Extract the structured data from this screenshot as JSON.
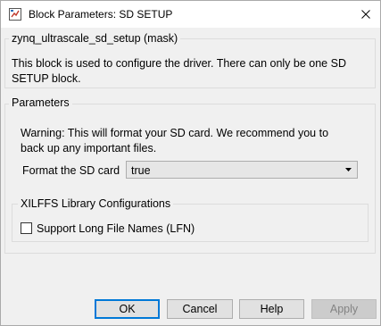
{
  "window": {
    "title": "Block Parameters: SD SETUP"
  },
  "description_group": {
    "legend": "zynq_ultrascale_sd_setup (mask)",
    "text_line1": "This block is used to configure the driver. There can only be one SD",
    "text_line2": "SETUP block."
  },
  "parameters_group": {
    "legend": "Parameters",
    "warning_line1": "Warning: This will format your SD card. We recommend you to",
    "warning_line2": "back up any important files.",
    "format_label": "Format the SD card",
    "format_value": "true"
  },
  "xilffs_group": {
    "legend": "XILFFS Library Configurations",
    "lfn_label": "Support Long File Names (LFN)",
    "lfn_checked": false
  },
  "buttons": {
    "ok": "OK",
    "cancel": "Cancel",
    "help": "Help",
    "apply": "Apply"
  },
  "colors": {
    "default_button_border": "#0078d7",
    "dialog_background": "#f0f0f0"
  },
  "icons": {
    "app": "block-parameters-icon",
    "close": "close-icon",
    "dropdown": "chevron-down-icon"
  }
}
